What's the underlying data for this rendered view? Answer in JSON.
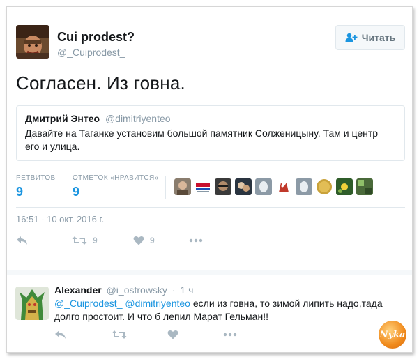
{
  "main_tweet": {
    "author_name": "Cui prodest?",
    "author_handle": "@_Cuiprodest_",
    "follow_label": "Читать",
    "text": "Согласен. Из говна.",
    "timestamp": "16:51 - 10 окт. 2016 г."
  },
  "quoted_tweet": {
    "author_name": "Дмитрий Энтео",
    "author_handle": "@dimitriyenteo",
    "text": "Давайте на Таганке установим большой памятник Солженицыну. Там и центр его и улица."
  },
  "stats": {
    "retweets_label": "РЕТВИТОВ",
    "retweets_value": "9",
    "likes_label": "ОТМЕТОК «НРАВИТСЯ»",
    "likes_value": "9"
  },
  "actions": {
    "retweet_count": "9",
    "like_count": "9"
  },
  "reply": {
    "author_name": "Alexander",
    "author_handle": "@i_ostrowsky",
    "separator": "·",
    "time": "1 ч",
    "mention1": "@_Cuiprodest_",
    "mention2": "@dimitriyenteo",
    "text": " если из говна, то зимой липить надо,тада долго простоит. И что б лепил Марат Гельман!!"
  },
  "watermark": {
    "text": "Nyka"
  },
  "colors": {
    "accent": "#1b95e0",
    "muted": "#8899a6",
    "icon": "#aab8c2"
  }
}
